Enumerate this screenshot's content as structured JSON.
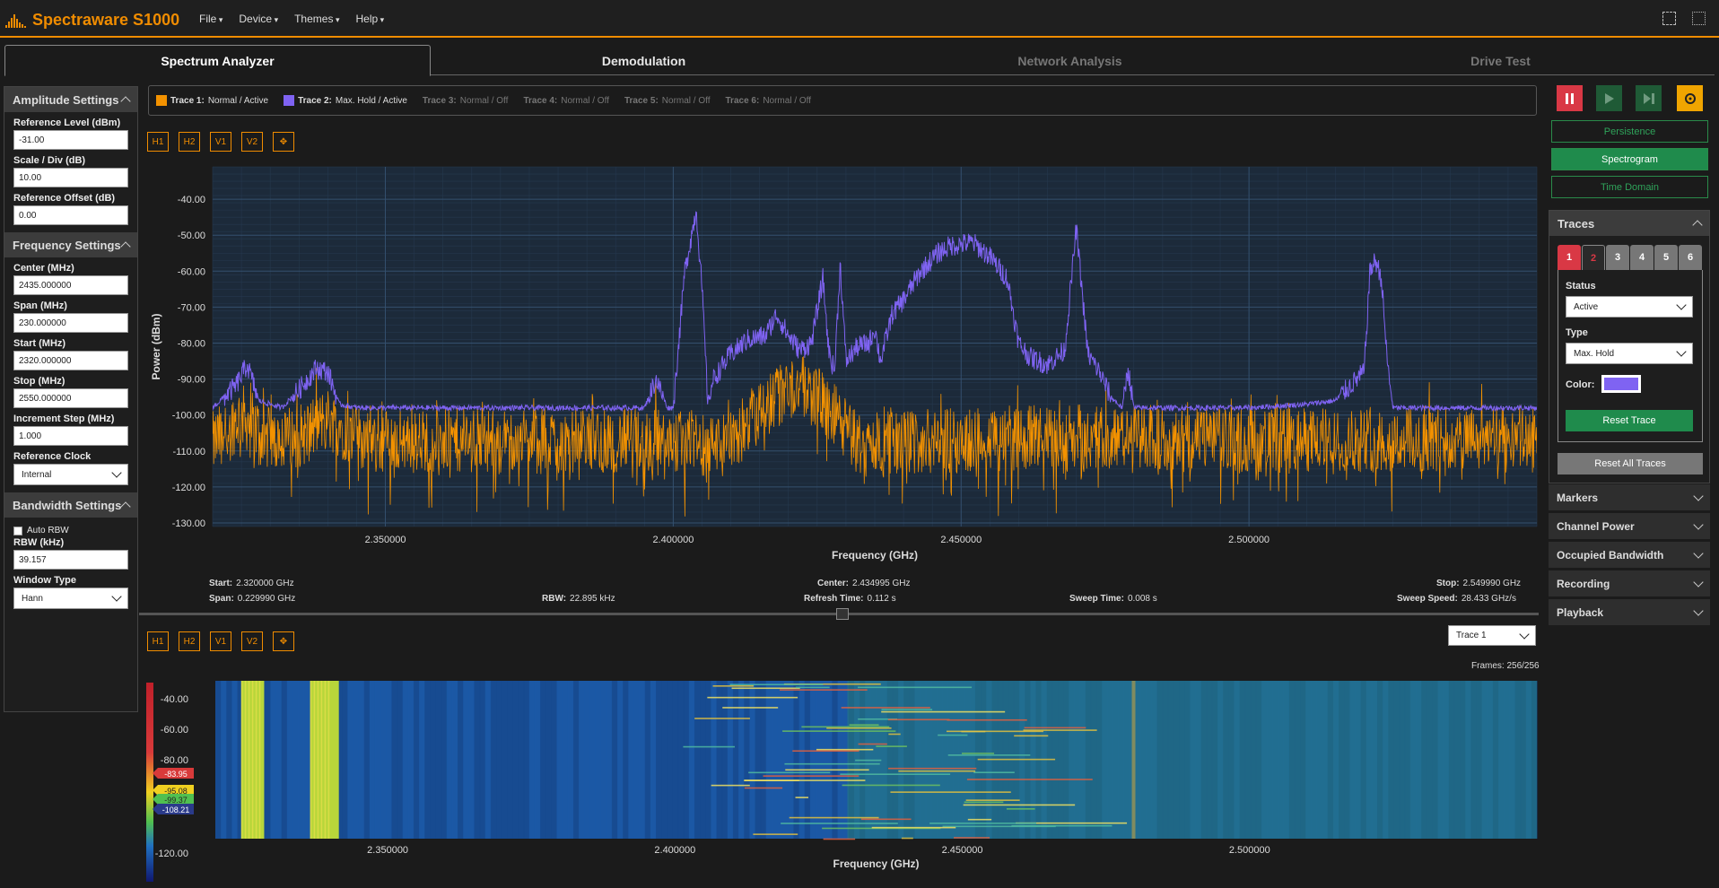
{
  "app": {
    "title": "Spectraware S1000"
  },
  "menu": [
    "File",
    "Device",
    "Themes",
    "Help"
  ],
  "tabs": [
    "Spectrum Analyzer",
    "Demodulation",
    "Network Analysis",
    "Drive Test"
  ],
  "amplitude": {
    "title": "Amplitude Settings",
    "ref_level_label": "Reference Level (dBm)",
    "ref_level": "-31.00",
    "scale_label": "Scale / Div (dB)",
    "scale": "10.00",
    "offset_label": "Reference Offset (dB)",
    "offset": "0.00"
  },
  "frequency": {
    "title": "Frequency Settings",
    "center_label": "Center (MHz)",
    "center": "2435.000000",
    "span_label": "Span (MHz)",
    "span": "230.000000",
    "start_label": "Start (MHz)",
    "start": "2320.000000",
    "stop_label": "Stop (MHz)",
    "stop": "2550.000000",
    "step_label": "Increment Step (MHz)",
    "step": "1.000",
    "clock_label": "Reference Clock",
    "clock": "Internal"
  },
  "bandwidth": {
    "title": "Bandwidth Settings",
    "auto_rbw": "Auto RBW",
    "rbw_label": "RBW (kHz)",
    "rbw": "39.157",
    "window_label": "Window Type",
    "window": "Hann"
  },
  "trace_legend": [
    {
      "name": "Trace 1:",
      "state": "Normal / Active",
      "color": "#f39200",
      "active": true
    },
    {
      "name": "Trace 2:",
      "state": "Max. Hold / Active",
      "color": "#7f63f2",
      "active": true
    },
    {
      "name": "Trace 3:",
      "state": "Normal / Off",
      "active": false
    },
    {
      "name": "Trace 4:",
      "state": "Normal / Off",
      "active": false
    },
    {
      "name": "Trace 5:",
      "state": "Normal / Off",
      "active": false
    },
    {
      "name": "Trace 6:",
      "state": "Normal / Off",
      "active": false
    }
  ],
  "marker_buttons": [
    "H1",
    "H2",
    "V1",
    "V2"
  ],
  "view_buttons": {
    "persistence": "Persistence",
    "spectrogram": "Spectrogram",
    "time_domain": "Time Domain"
  },
  "traces_panel": {
    "title": "Traces",
    "tabs": [
      "1",
      "2",
      "3",
      "4",
      "5",
      "6"
    ],
    "status_label": "Status",
    "status": "Active",
    "type_label": "Type",
    "type": "Max. Hold",
    "color_label": "Color:",
    "color": "#7f63f2",
    "reset_trace": "Reset Trace",
    "reset_all": "Reset All Traces"
  },
  "collapsed_panels": [
    "Markers",
    "Channel Power",
    "Occupied Bandwidth",
    "Recording",
    "Playback"
  ],
  "sweep_info": {
    "start_label": "Start:",
    "start": "2.320000 GHz",
    "span_label": "Span:",
    "span": "0.229990 GHz",
    "rbw_label": "RBW:",
    "rbw": "22.895 kHz",
    "center_label": "Center:",
    "center": "2.434995 GHz",
    "refresh_label": "Refresh Time:",
    "refresh": "0.112 s",
    "sweep_label": "Sweep Time:",
    "sweep": "0.008 s",
    "stop_label": "Stop:",
    "stop": "2.549990 GHz",
    "speed_label": "Sweep Speed:",
    "speed": "28.433 GHz/s"
  },
  "spectrogram": {
    "trace_select": "Trace 1",
    "frames": "Frames: 256/256",
    "scale_ticks": [
      "-40.00",
      "-60.00",
      "-80.00",
      "-100.00",
      "-120.00"
    ],
    "scale_markers": [
      "-83.95",
      "-95.08",
      "-99.37",
      "-108.21"
    ],
    "xlabel": "Frequency (GHz)",
    "xticks": [
      "2.350000",
      "2.400000",
      "2.450000",
      "2.500000"
    ]
  },
  "chart_data": {
    "type": "line",
    "xlabel": "Frequency (GHz)",
    "ylabel": "Power (dBm)",
    "xlim": [
      2.32,
      2.55
    ],
    "ylim": [
      -131,
      -31
    ],
    "xticks": [
      2.35,
      2.4,
      2.45,
      2.5
    ],
    "xtick_labels": [
      "2.350000",
      "2.400000",
      "2.450000",
      "2.500000"
    ],
    "yticks": [
      -40,
      -50,
      -60,
      -70,
      -80,
      -90,
      -100,
      -110,
      -120,
      -130
    ],
    "ytick_labels": [
      "-40.00",
      "-50.00",
      "-60.00",
      "-70.00",
      "-80.00",
      "-90.00",
      "-100.00",
      "-110.00",
      "-120.00",
      "-130.00"
    ],
    "grid": true,
    "series": [
      {
        "name": "Trace 2: Max. Hold",
        "color": "#7f63f2",
        "x": [
          2.32,
          2.324,
          2.326,
          2.328,
          2.332,
          2.335,
          2.338,
          2.34,
          2.342,
          2.345,
          2.35,
          2.36,
          2.37,
          2.38,
          2.39,
          2.395,
          2.397,
          2.399,
          2.4,
          2.402,
          2.404,
          2.405,
          2.406,
          2.407,
          2.41,
          2.413,
          2.416,
          2.418,
          2.42,
          2.422,
          2.424,
          2.426,
          2.427,
          2.428,
          2.429,
          2.43,
          2.432,
          2.434,
          2.435,
          2.436,
          2.438,
          2.44,
          2.443,
          2.446,
          2.448,
          2.452,
          2.455,
          2.458,
          2.46,
          2.462,
          2.465,
          2.468,
          2.47,
          2.472,
          2.474,
          2.476,
          2.478,
          2.479,
          2.48,
          2.482,
          2.485,
          2.49,
          2.5,
          2.51,
          2.515,
          2.52,
          2.521,
          2.522,
          2.523,
          2.524,
          2.525,
          2.53,
          2.54,
          2.55
        ],
        "y": [
          -98,
          -92,
          -86,
          -96,
          -98,
          -93,
          -87,
          -88,
          -97,
          -98,
          -98,
          -98,
          -98,
          -98,
          -98,
          -98,
          -90,
          -98,
          -98,
          -60,
          -43,
          -65,
          -96,
          -90,
          -83,
          -79,
          -78,
          -72,
          -78,
          -82,
          -80,
          -62,
          -82,
          -88,
          -58,
          -85,
          -81,
          -80,
          -76,
          -85,
          -72,
          -68,
          -60,
          -55,
          -53,
          -52,
          -56,
          -62,
          -80,
          -84,
          -86,
          -82,
          -48,
          -83,
          -88,
          -95,
          -98,
          -87,
          -98,
          -98,
          -98,
          -98,
          -98,
          -97,
          -96,
          -88,
          -60,
          -57,
          -62,
          -85,
          -98,
          -98,
          -98,
          -98
        ]
      },
      {
        "name": "Trace 1: Normal",
        "color": "#f39200",
        "x": [
          2.32,
          2.325,
          2.33,
          2.335,
          2.34,
          2.345,
          2.35,
          2.37,
          2.39,
          2.4,
          2.405,
          2.41,
          2.413,
          2.416,
          2.419,
          2.422,
          2.425,
          2.428,
          2.432,
          2.45,
          2.47,
          2.49,
          2.51,
          2.53,
          2.55
        ],
        "y": [
          -108,
          -100,
          -107,
          -106,
          -101,
          -106,
          -107,
          -107,
          -107,
          -107,
          -108,
          -107,
          -103,
          -98,
          -93,
          -92,
          -95,
          -100,
          -108,
          -107,
          -106,
          -107,
          -107,
          -107,
          -107
        ]
      }
    ]
  }
}
